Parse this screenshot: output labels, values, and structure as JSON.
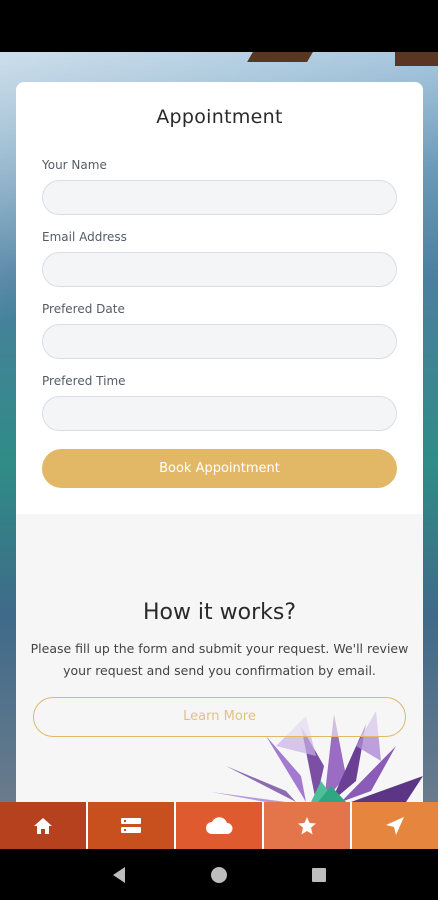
{
  "form": {
    "title": "Appointment",
    "fields": [
      {
        "label": "Your Name",
        "value": "",
        "placeholder": ""
      },
      {
        "label": "Email Address",
        "value": "",
        "placeholder": ""
      },
      {
        "label": "Prefered Date",
        "value": "",
        "placeholder": ""
      },
      {
        "label": "Prefered Time",
        "value": "",
        "placeholder": ""
      }
    ],
    "submit_label": "Book Appointment"
  },
  "how": {
    "title": "How it works?",
    "text": "Please fill up the form and submit your request. We'll review your request and send you confirmation by email.",
    "button_label": "Learn More"
  },
  "bottom_nav": {
    "items": [
      {
        "icon": "home-icon",
        "color": "#b5411f"
      },
      {
        "icon": "list-icon",
        "color": "#c8501f"
      },
      {
        "icon": "cloud-icon",
        "color": "#df5a2e"
      },
      {
        "icon": "star-icon",
        "color": "#e4744a"
      },
      {
        "icon": "navigation-arrow-icon",
        "color": "#e6863e"
      }
    ]
  },
  "colors": {
    "accent": "#e2b866"
  }
}
